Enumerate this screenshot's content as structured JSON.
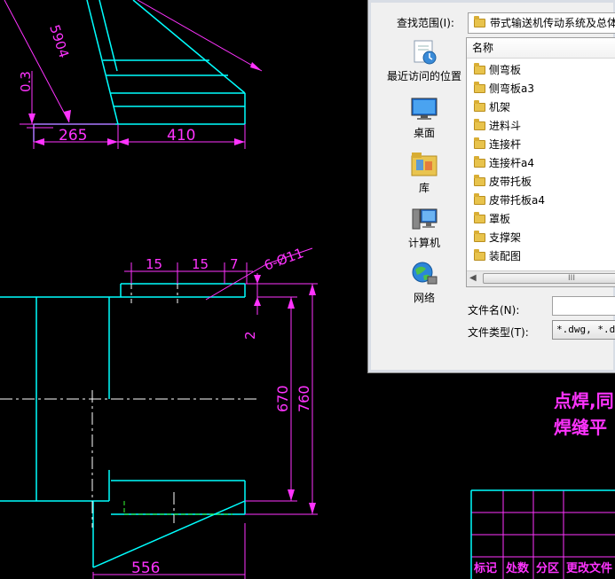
{
  "drawing": {
    "dims": {
      "d5904": "5904",
      "d03": "0.3",
      "d265": "265",
      "d410": "410",
      "d15a": "15",
      "d15b": "15",
      "d7": "7",
      "d6phi11": "6-Ø11",
      "d2": "2",
      "d670": "670",
      "d760": "760",
      "d556": "556"
    },
    "notes": [
      "点焊,同",
      "焊缝平"
    ],
    "title_block": [
      "标记",
      "处数",
      "分区",
      "更改文件"
    ]
  },
  "dialog": {
    "look_in_label": "查找范围(I):",
    "look_in_value": "带式输送机传动系统及总体",
    "places": [
      {
        "label": "最近访问的位置",
        "icon": "recent-places-icon"
      },
      {
        "label": "桌面",
        "icon": "desktop-icon"
      },
      {
        "label": "库",
        "icon": "libraries-icon"
      },
      {
        "label": "计算机",
        "icon": "computer-icon"
      },
      {
        "label": "网络",
        "icon": "network-icon"
      }
    ],
    "list_header": "名称",
    "files": [
      "侧弯板",
      "侧弯板a3",
      "机架",
      "进料斗",
      "连接杆",
      "连接杆a4",
      "皮带托板",
      "皮带托板a4",
      "罩板",
      "支撑架",
      "装配图"
    ],
    "scroll_thumb": "III",
    "file_name_label": "文件名(N):",
    "file_name_value": "",
    "file_type_label": "文件类型(T):",
    "file_type_value": "*.dwg, *.dxf"
  },
  "colors": {
    "dimension": "#ff33ff",
    "outline": "#00ffff",
    "center": "#ffffff",
    "hidden": "#33ff33"
  }
}
